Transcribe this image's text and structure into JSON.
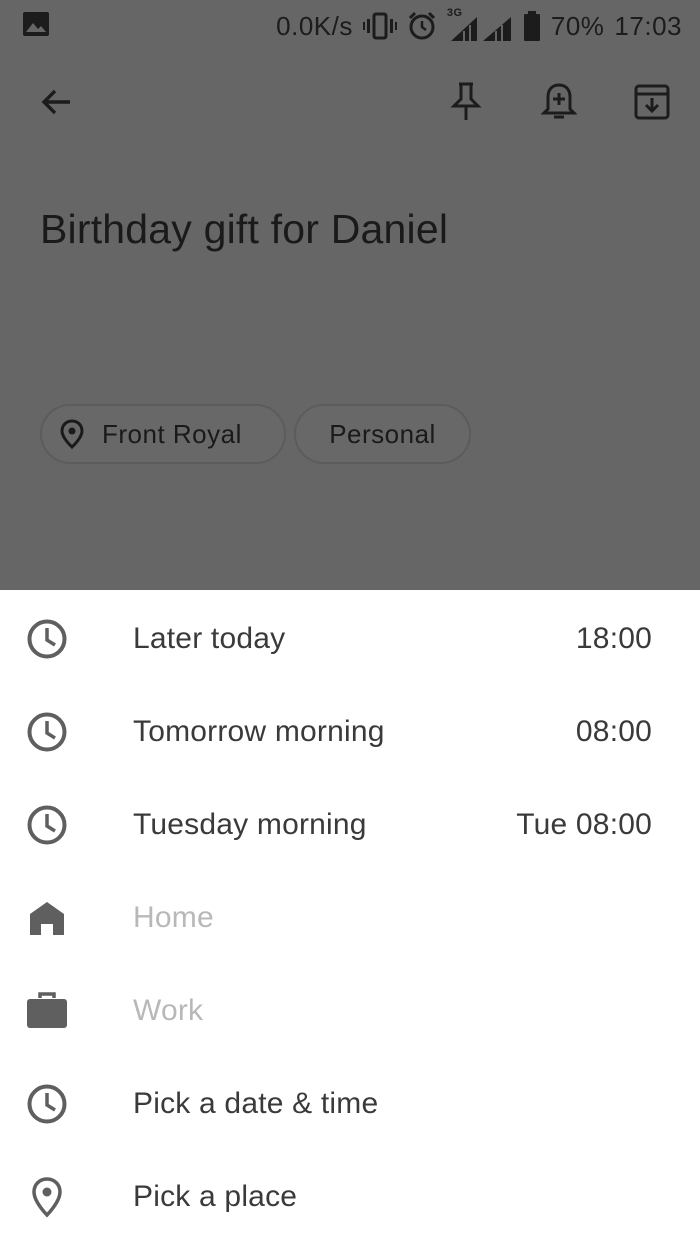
{
  "status_bar": {
    "network_speed": "0.0K/s",
    "network_type": "3G",
    "battery": "70%",
    "time": "17:03",
    "icons": [
      "image-icon",
      "vibrate-icon",
      "alarm-icon",
      "signal-icon",
      "battery-icon"
    ]
  },
  "toolbar": {
    "icons": [
      "back-arrow-icon",
      "pin-icon",
      "add-reminder-icon",
      "archive-icon"
    ]
  },
  "note": {
    "title": "Birthday gift for Daniel",
    "chips": [
      {
        "label": "Front Royal",
        "icon": "location-pin-icon"
      },
      {
        "label": "Personal"
      }
    ]
  },
  "reminder_sheet": {
    "items": [
      {
        "label": "Later today",
        "time": "18:00",
        "icon": "clock-icon",
        "enabled": true
      },
      {
        "label": "Tomorrow morning",
        "time": "08:00",
        "icon": "clock-icon",
        "enabled": true
      },
      {
        "label": "Tuesday morning",
        "time": "Tue 08:00",
        "icon": "clock-icon",
        "enabled": true
      },
      {
        "label": "Home",
        "time": "",
        "icon": "home-icon",
        "enabled": false
      },
      {
        "label": "Work",
        "time": "",
        "icon": "briefcase-icon",
        "enabled": false
      },
      {
        "label": "Pick a date & time",
        "time": "",
        "icon": "clock-icon",
        "enabled": true
      },
      {
        "label": "Pick a place",
        "time": "",
        "icon": "location-pin-icon",
        "enabled": true
      }
    ]
  },
  "colors": {
    "scrim_background": "#666666",
    "sheet_background": "#ffffff",
    "text_primary": "#3a3a3a",
    "text_disabled": "#b8b8b8",
    "icon": "#5f5f5f"
  }
}
